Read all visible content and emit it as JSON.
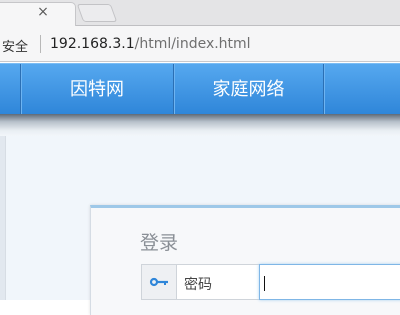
{
  "browser": {
    "close_tab_glyph": "×",
    "insecure_label": "安全",
    "url_host": "192.168.3.1",
    "url_path": "/html/index.html"
  },
  "nav": {
    "items": [
      {
        "label": "因特网"
      },
      {
        "label": "家庭网络"
      }
    ]
  },
  "login": {
    "title": "登录",
    "password_label": "密码",
    "password_value": "",
    "key_icon": "key-icon"
  },
  "colors": {
    "nav_top": "#56a8ef",
    "nav_bottom": "#2f86d9",
    "card_accent": "#9ec8e8",
    "input_focus": "#7fb6e6"
  }
}
